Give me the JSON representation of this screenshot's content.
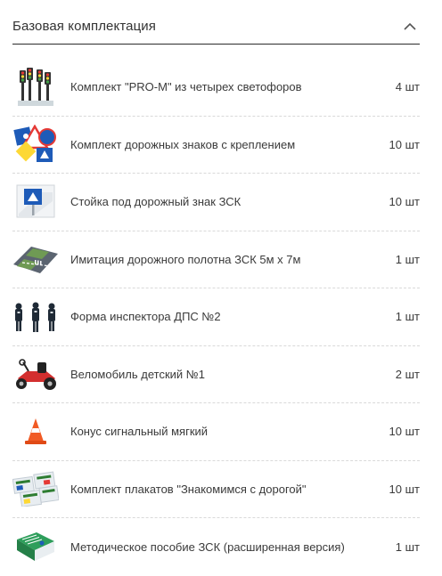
{
  "section": {
    "title": "Базовая комплектация",
    "expanded": true
  },
  "items": [
    {
      "name": "Комплект \"PRO-M\" из четырех светофоров",
      "qty": "4 шт",
      "icon": "traffic-lights-set-icon"
    },
    {
      "name": "Комплект дорожных знаков с креплением",
      "qty": "10 шт",
      "icon": "road-signs-set-icon"
    },
    {
      "name": "Стойка под дорожный знак ЗСК",
      "qty": "10 шт",
      "icon": "sign-stand-icon"
    },
    {
      "name": "Имитация дорожного полотна ЗСК 5м х 7м",
      "qty": "1 шт",
      "icon": "road-mat-icon"
    },
    {
      "name": "Форма инспектора ДПС №2",
      "qty": "1 шт",
      "icon": "police-uniform-icon"
    },
    {
      "name": "Веломобиль детский №1",
      "qty": "2 шт",
      "icon": "pedal-kart-icon"
    },
    {
      "name": "Конус сигнальный мягкий",
      "qty": "10 шт",
      "icon": "traffic-cone-icon"
    },
    {
      "name": "Комплект плакатов \"Знакомимся с дорогой\"",
      "qty": "10 шт",
      "icon": "posters-set-icon"
    },
    {
      "name": "Методическое пособие ЗСК (расширенная версия)",
      "qty": "1 шт",
      "icon": "manual-book-icon"
    }
  ]
}
